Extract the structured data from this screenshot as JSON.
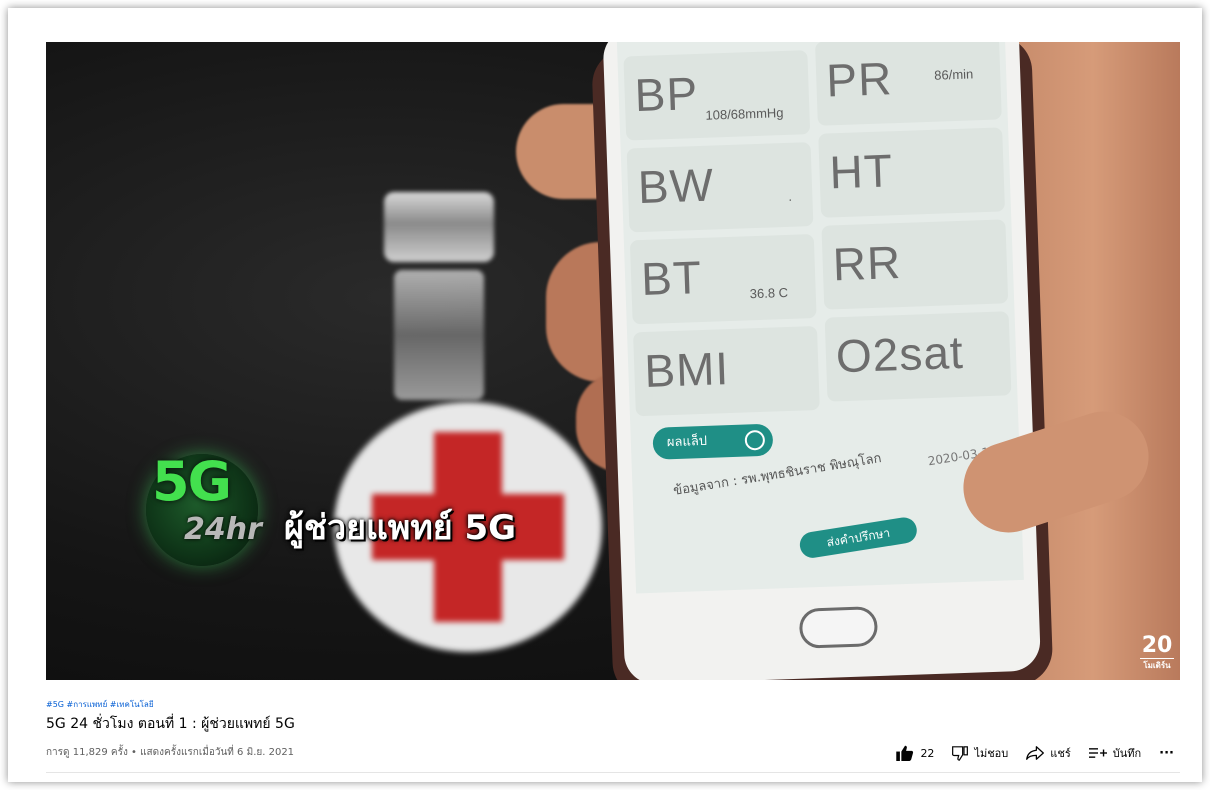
{
  "video": {
    "overlay_logo_5g": "5G",
    "overlay_logo_24hr": "24hr",
    "overlay_caption": "ผู้ช่วยแพทย์ 5G",
    "channel_mark_number": "20",
    "channel_mark_sub": "โมเดิร์น",
    "phone_screen": {
      "tiles": [
        {
          "label": "BP",
          "value": "108/68mmHg"
        },
        {
          "label": "PR",
          "value": "86/min"
        },
        {
          "label": "BW",
          "value": "."
        },
        {
          "label": "HT",
          "value": ""
        },
        {
          "label": "BT",
          "value": "36.8 C"
        },
        {
          "label": "RR",
          "value": ""
        },
        {
          "label": "BMI",
          "value": ""
        },
        {
          "label": "O2sat",
          "value": ""
        }
      ],
      "lab_button": "ผลแล็ป",
      "source_text": "ข้อมูลจาก : รพ.พุทธชินราช พิษณุโลก",
      "date_text": "2020-03-11",
      "consult_button": "ส่งคำปรึกษา"
    }
  },
  "info": {
    "hashtags": "#5G #การแพทย์ #เทคโนโลยี",
    "title": "5G 24 ชั่วโมง ตอนที่ 1 : ผู้ช่วยแพทย์ 5G",
    "meta": "การดู 11,829 ครั้ง • แสดงครั้งแรกเมื่อวันที่ 6 มิ.ย. 2021"
  },
  "actions": {
    "like_count": "22",
    "dislike_label": "ไม่ชอบ",
    "share_label": "แชร์",
    "save_label": "บันทึก",
    "more_label": "···"
  },
  "colors": {
    "link": "#065fd4",
    "text_primary": "#030303",
    "text_secondary": "#606060",
    "app_teal": "#1f8f86",
    "logo_green": "#43e04e",
    "red_cross": "#c42626"
  }
}
